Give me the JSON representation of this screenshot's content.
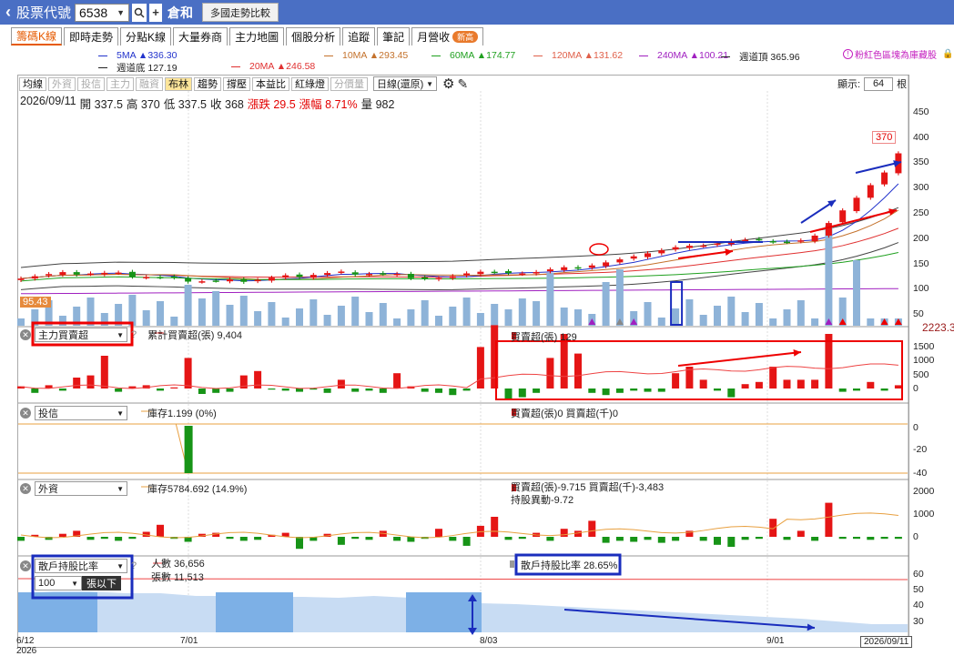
{
  "topbar": {
    "back_icon": "back-arrow-icon",
    "label": "股票代號",
    "code": "6538",
    "search_icon": "search-icon",
    "add": "+",
    "stock_name": "倉和",
    "compare": "多國走勢比較"
  },
  "tabs": [
    {
      "label": "籌碼K線",
      "active": true
    },
    {
      "label": "即時走勢"
    },
    {
      "label": "分點K線"
    },
    {
      "label": "大量券商"
    },
    {
      "label": "主力地圖"
    },
    {
      "label": "個股分析"
    },
    {
      "label": "追蹤"
    },
    {
      "label": "筆記"
    },
    {
      "label": "月營收",
      "badge": "新高"
    }
  ],
  "ma_legend": [
    {
      "text": "5MA ▲336.30",
      "color": "#2233cc"
    },
    {
      "text": "10MA ▲293.45",
      "color": "#c4722c"
    },
    {
      "text": "60MA ▲174.77",
      "color": "#1fa01f"
    },
    {
      "text": "120MA ▲131.62",
      "color": "#e0604a"
    },
    {
      "text": "240MA ▲100.21",
      "color": "#a020c0"
    },
    {
      "text": "週道頂 365.96",
      "color": "#222222"
    },
    {
      "text": "週道底 127.19",
      "color": "#222222"
    },
    {
      "text": "20MA ▲246.58",
      "color": "#e03030"
    }
  ],
  "side_tip": "粉紅色區塊為庫藏股",
  "tools": [
    {
      "label": "均線"
    },
    {
      "label": "外資",
      "dim": true
    },
    {
      "label": "投信",
      "dim": true
    },
    {
      "label": "主力",
      "dim": true
    },
    {
      "label": "融資",
      "dim": true
    },
    {
      "label": "布林",
      "hl": true
    },
    {
      "label": "趨勢"
    },
    {
      "label": "撐壓"
    },
    {
      "label": "本益比"
    },
    {
      "label": "紅綠燈"
    },
    {
      "label": "分價量",
      "dim": true
    }
  ],
  "period": "日線(還原)",
  "display": {
    "label": "顯示:",
    "value": "64",
    "unit": "根"
  },
  "ohlc": {
    "date": "2026/09/11",
    "open": "開 337.5",
    "high": "高 370",
    "low": "低 337.5",
    "close": "收 368",
    "change": "漲跌 29.5",
    "pct": "漲幅 8.71%",
    "vol": "量 982"
  },
  "price_axis": [
    "450",
    "400",
    "350",
    "300",
    "250",
    "200",
    "150",
    "100",
    "50"
  ],
  "price_labels": {
    "last": "370",
    "ma_flag": "95.43",
    "right": "2223.3"
  },
  "panel1": {
    "select": "主力買賣超",
    "legend1": "累計買賣超(張) 9,404",
    "legend2": "買賣超(張) 129",
    "axis": [
      "1500",
      "1000",
      "500",
      "0"
    ]
  },
  "panel2": {
    "select": "投信",
    "legend1": "庫存1.199 (0%)",
    "legend2": "買賣超(張)0 買賣超(千)0",
    "axis": [
      "0",
      "-20",
      "-40"
    ]
  },
  "panel3": {
    "select": "外資",
    "legend1": "庫存5784.692 (14.9%)",
    "legend2": "買賣超(張)-9.715 買賣超(千)-3,483",
    "legend3": "持股異動-9.72",
    "axis": [
      "2000",
      "1000",
      "0"
    ]
  },
  "panel4": {
    "select": "散戶持股比率",
    "sub_value": "100",
    "sub_unit": "張以下",
    "legend1": "人數 36,656",
    "legend2": "張數 11,513",
    "legend3": "散戶持股比率 28.65%",
    "axis": [
      "60",
      "50",
      "40",
      "30"
    ]
  },
  "x_axis": [
    {
      "label": "6/12"
    },
    {
      "label": "2026"
    },
    {
      "label": "7/01"
    },
    {
      "label": "8/03"
    },
    {
      "label": "9/01"
    },
    {
      "label": "2026/09/11"
    }
  ],
  "question": "?"
}
